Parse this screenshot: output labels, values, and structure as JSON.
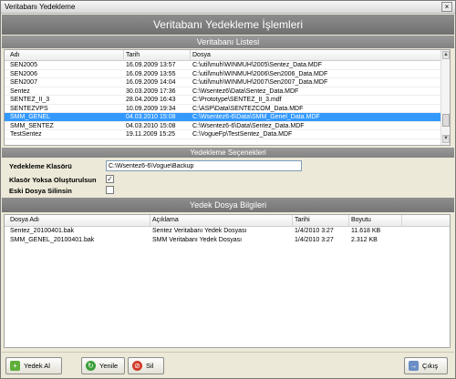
{
  "window": {
    "title": "Veritabanı Yedekleme",
    "close_glyph": "×"
  },
  "header": {
    "title": "Veritabanı Yedekleme İşlemleri"
  },
  "db_list": {
    "section_title": "Veritabanı Listesi",
    "columns": [
      "Adı",
      "Tarih",
      "Dosya"
    ],
    "rows": [
      {
        "name": "SEN2005",
        "date": "16.09.2009 13:57",
        "file": "C:\\util\\muh\\WINMUH\\2005\\Sentez_Data.MDF"
      },
      {
        "name": "SEN2006",
        "date": "16.09.2009 13:55",
        "file": "C:\\util\\muh\\WINMUH\\2006\\Sen2006_Data.MDF"
      },
      {
        "name": "SEN2007",
        "date": "16.09.2009 14:04",
        "file": "C:\\util\\muh\\WINMUH\\2007\\Sen2007_Data.MDF"
      },
      {
        "name": "Sentez",
        "date": "30.03.2009 17:36",
        "file": "C:\\Wsentez6\\Data\\Sentez_Data.MDF"
      },
      {
        "name": "SENTEZ_II_3",
        "date": "28.04.2009 16:43",
        "file": "C:\\Prototype\\SENTEZ_II_3.mdf"
      },
      {
        "name": "SENTEZVPS",
        "date": "10.09.2009 19:34",
        "file": "C:\\ASP\\Data\\SENTEZCOM_Data.MDF"
      },
      {
        "name": "SMM_GENEL",
        "date": "04.03.2010 15:08",
        "file": "C:\\Wsentez6-6\\Data\\SMM_Genel_Data.MDF"
      },
      {
        "name": "SMM_SENTEZ",
        "date": "04.03.2010 15:08",
        "file": "C:\\Wsentez6-6\\Data\\Sentez_Data.MDF"
      },
      {
        "name": "TestSentez",
        "date": "19.11.2009 15:25",
        "file": "C:\\VogueFp\\TestSentez_Data.MDF"
      }
    ],
    "selected_index": 6
  },
  "options": {
    "section_title": "Yedekleme Seçenekleri",
    "folder_label": "Yedekleme Klasörü",
    "folder_value": "C:\\Wsentez6-6\\Vogue\\Backup",
    "create_folder_label": "Klasör Yoksa Oluşturulsun",
    "create_folder_checked_glyph": "✓",
    "delete_old_label": "Eski Dosya Silinsin",
    "delete_old_checked_glyph": ""
  },
  "backups": {
    "section_title": "Yedek Dosya Bilgileri",
    "columns": [
      "Dosya Adı",
      "Açıklama",
      "Tarihi",
      "Boyutu"
    ],
    "rows": [
      {
        "file": "Sentez_20100401.bak",
        "desc": "Sentez Veritabanı Yedek Dosyası",
        "date": "1/4/2010 3:27",
        "size": "11.618 KB"
      },
      {
        "file": "SMM_GENEL_20100401.bak",
        "desc": "SMM Veritabanı Yedek Dosyası",
        "date": "1/4/2010 3:27",
        "size": "2.312 KB"
      }
    ]
  },
  "footer": {
    "backup_label": "Yedek Al",
    "refresh_label": "Yenile",
    "delete_label": "Sil",
    "exit_label": "Çıkış",
    "backup_glyph": "+",
    "refresh_glyph": "↻",
    "delete_glyph": "⊘",
    "exit_glyph": "→"
  },
  "scroll": {
    "up_glyph": "▲",
    "down_glyph": "▼"
  }
}
